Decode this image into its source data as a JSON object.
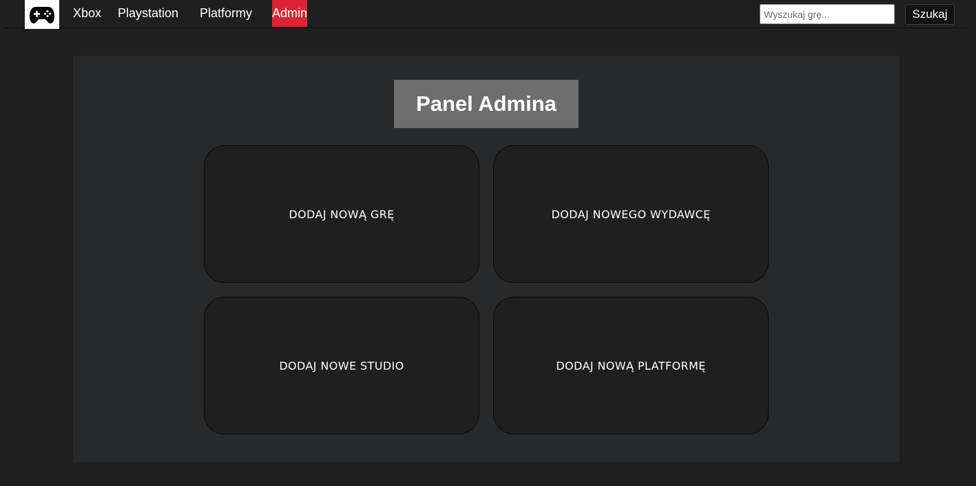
{
  "nav": {
    "logo_icon": "gamepad-icon",
    "links": [
      {
        "label": "Xbox",
        "active": false
      },
      {
        "label": "Playstation",
        "active": false
      },
      {
        "label": "Platformy",
        "active": false
      },
      {
        "label": "Admin",
        "active": true
      }
    ],
    "search": {
      "placeholder": "Wyszukaj grę...",
      "value": "",
      "button_label": "Szukaj"
    }
  },
  "panel": {
    "title": "Panel Admina",
    "cards": [
      {
        "label": "DODAJ NOWĄ GRĘ"
      },
      {
        "label": "DODAJ NOWEGO WYDAWCĘ"
      },
      {
        "label": "DODAJ NOWE STUDIO"
      },
      {
        "label": "DODAJ NOWĄ PLATFORMĘ"
      }
    ]
  },
  "colors": {
    "background": "#1f1f20",
    "panel_background": "#28292b",
    "title_box": "#6e6e6e",
    "active_link": "#dc2435",
    "card_background": "#1f1f20"
  }
}
